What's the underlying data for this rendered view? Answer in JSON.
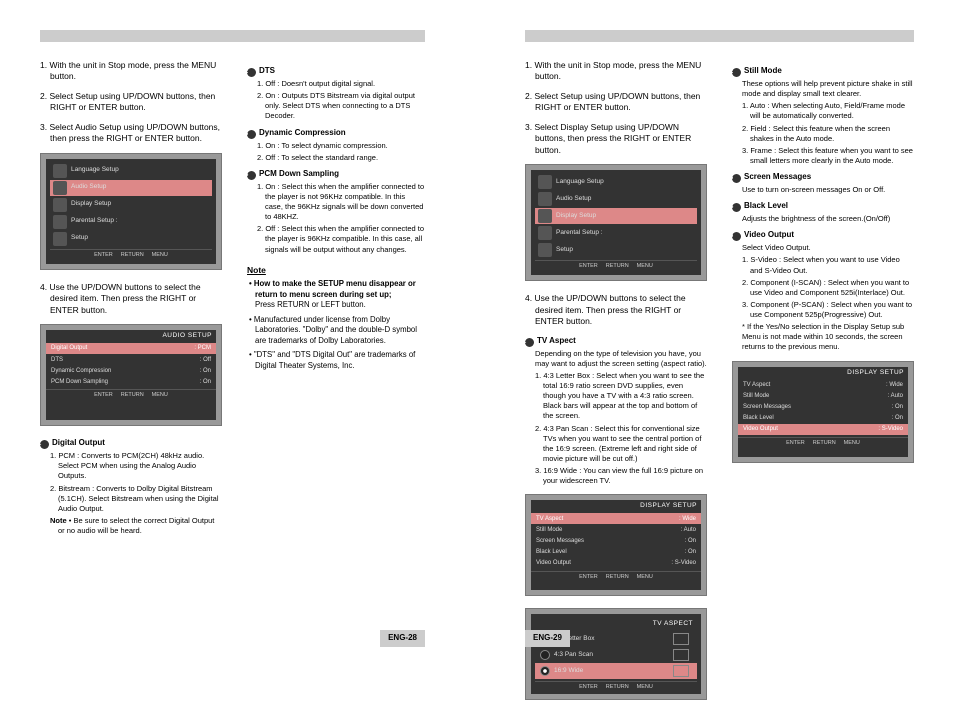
{
  "left": {
    "steps": [
      "1. With the unit in Stop mode, press the MENU button.",
      "2. Select Setup using UP/DOWN buttons, then RIGHT or ENTER button.",
      "3. Select Audio Setup using UP/DOWN buttons, then press the RIGHT or ENTER button.",
      "4. Use the UP/DOWN buttons to select the desired item. Then press the RIGHT or ENTER button."
    ],
    "osd_main": {
      "items": [
        "Language Setup",
        "Audio Setup",
        "Display Setup",
        "Parental Setup :",
        "Setup"
      ],
      "buttons": [
        "ENTER",
        "RETURN",
        "MENU"
      ]
    },
    "osd_audio": {
      "title": "AUDIO SETUP",
      "rows": [
        {
          "label": "Digital Output",
          "value": ": PCM",
          "sel": true
        },
        {
          "label": "DTS",
          "value": ": Off"
        },
        {
          "label": "Dynamic Compression",
          "value": ": On"
        },
        {
          "label": "PCM Down Sampling",
          "value": ": On"
        }
      ],
      "buttons": [
        "ENTER",
        "RETURN",
        "MENU"
      ]
    },
    "digital": {
      "title": "Digital Output",
      "items": [
        "1. PCM : Converts to PCM(2CH) 48kHz audio. Select PCM when using the Analog Audio Outputs.",
        "2. Bitstream : Converts to Dolby Digital Bitstream (5.1CH). Select Bitstream when using the Digital Audio Output."
      ],
      "note_lbl": "Note",
      "note": "• Be sure to select the correct Digital Output or no audio will be heard."
    },
    "dts": {
      "title": "DTS",
      "items": [
        "1. Off : Doesn't output digital signal.",
        "2. On : Outputs DTS Bitstream via digital output only. Select DTS when connecting to a DTS Decoder."
      ]
    },
    "dyn": {
      "title": "Dynamic Compression",
      "items": [
        "1. On : To select dynamic compression.",
        "2. Off : To select the standard range."
      ]
    },
    "pcm": {
      "title": "PCM Down Sampling",
      "items": [
        "1. On : Select this when the amplifier connected to the player is not 96KHz compatible. In this case, the 96KHz signals will be down converted to 48KHZ.",
        "2. Off : Select this when the amplifier connected to the player is 96KHz compatible. In this case, all signals will be output without any changes."
      ]
    },
    "notehead": "Note",
    "bold": "• How to make the SETUP menu disappear or return to menu screen during set up;",
    "press": "Press RETURN or LEFT button.",
    "b1": "• Manufactured under license from Dolby Laboratories. \"Dolby\" and the double-D symbol are trademarks of Dolby Laboratories.",
    "b2": "• \"DTS\" and \"DTS Digital Out\" are trademarks of Digital Theater Systems, Inc.",
    "pagenum": "ENG-28"
  },
  "right": {
    "steps": [
      "1. With the unit in Stop mode, press the MENU button.",
      "2. Select Setup using UP/DOWN buttons, then RIGHT or ENTER button.",
      "3. Select Display Setup using UP/DOWN buttons, then press the RIGHT or ENTER button.",
      "4. Use the UP/DOWN buttons to select the desired item. Then press the RIGHT or ENTER button."
    ],
    "osd_main": {
      "items": [
        "Language Setup",
        "Audio Setup",
        "Display Setup",
        "Parental Setup :",
        "Setup"
      ],
      "buttons": [
        "ENTER",
        "RETURN",
        "MENU"
      ]
    },
    "tva": {
      "title": "TV Aspect",
      "intro": "Depending on the type of television you have, you may want to adjust the screen setting (aspect ratio).",
      "items": [
        "1. 4:3 Letter Box : Select when you want to see the total 16:9 ratio screen DVD supplies, even though you have a TV with a 4:3 ratio screen. Black bars will appear at the top and bottom of the screen.",
        "2. 4:3 Pan Scan : Select this for conventional size TVs when you want to see the central portion of the 16:9 screen. (Extreme left and right side of movie picture will be cut off.)",
        "3. 16:9 Wide : You can view the full 16:9 picture on your widescreen TV."
      ]
    },
    "osd_disp": {
      "title": "DISPLAY SETUP",
      "rows": [
        {
          "label": "TV Aspect",
          "value": ": Wide",
          "sel": true
        },
        {
          "label": "Still Mode",
          "value": ": Auto"
        },
        {
          "label": "Screen Messages",
          "value": ": On"
        },
        {
          "label": "Black Level",
          "value": ": On"
        },
        {
          "label": "Video Output",
          "value": ": S-Video"
        }
      ],
      "buttons": [
        "ENTER",
        "RETURN",
        "MENU"
      ]
    },
    "osd_tva": {
      "title": "TV ASPECT",
      "rows": [
        {
          "label": "4:3 Letter Box",
          "on": false
        },
        {
          "label": "4:3 Pan Scan",
          "on": false
        },
        {
          "label": "16:9 Wide",
          "on": true,
          "sel": true
        }
      ],
      "buttons": [
        "ENTER",
        "RETURN",
        "MENU"
      ]
    },
    "still": {
      "title": "Still Mode",
      "intro": "These options will help prevent picture shake in still mode and display small text clearer.",
      "items": [
        "1. Auto : When selecting Auto, Field/Frame mode will be automatically converted.",
        "2. Field : Select this feature when the screen shakes in the Auto mode.",
        "3. Frame : Select this feature when you want to see small letters more clearly in the Auto mode."
      ]
    },
    "scr": {
      "title": "Screen Messages",
      "text": "Use to turn on-screen messages On or Off."
    },
    "blk": {
      "title": "Black Level",
      "text": "Adjusts the brightness of the screen.(On/Off)"
    },
    "vid": {
      "title": "Video Output",
      "intro": "Select Video Output.",
      "items": [
        "1. S-Video : Select when you want to use Video and S-Video Out.",
        "2. Component (I-SCAN) : Select when you want to use Video and Component 525i(Interlace) Out.",
        "3. Component (P-SCAN) : Select when you want to use Component 525p(Progressive) Out."
      ],
      "foot": "* If the Yes/No selection in the Display Setup sub Menu is not made within 10 seconds, the screen returns to the previous menu."
    },
    "osd_disp2": {
      "title": "DISPLAY SETUP",
      "rows": [
        {
          "label": "TV Aspect",
          "value": ": Wide"
        },
        {
          "label": "Still Mode",
          "value": ": Auto"
        },
        {
          "label": "Screen Messages",
          "value": ": On"
        },
        {
          "label": "Black Level",
          "value": ": On"
        },
        {
          "label": "Video Output",
          "value": ": S-Video",
          "sel": true
        }
      ],
      "buttons": [
        "ENTER",
        "RETURN",
        "MENU"
      ]
    },
    "pagenum": "ENG-29"
  }
}
